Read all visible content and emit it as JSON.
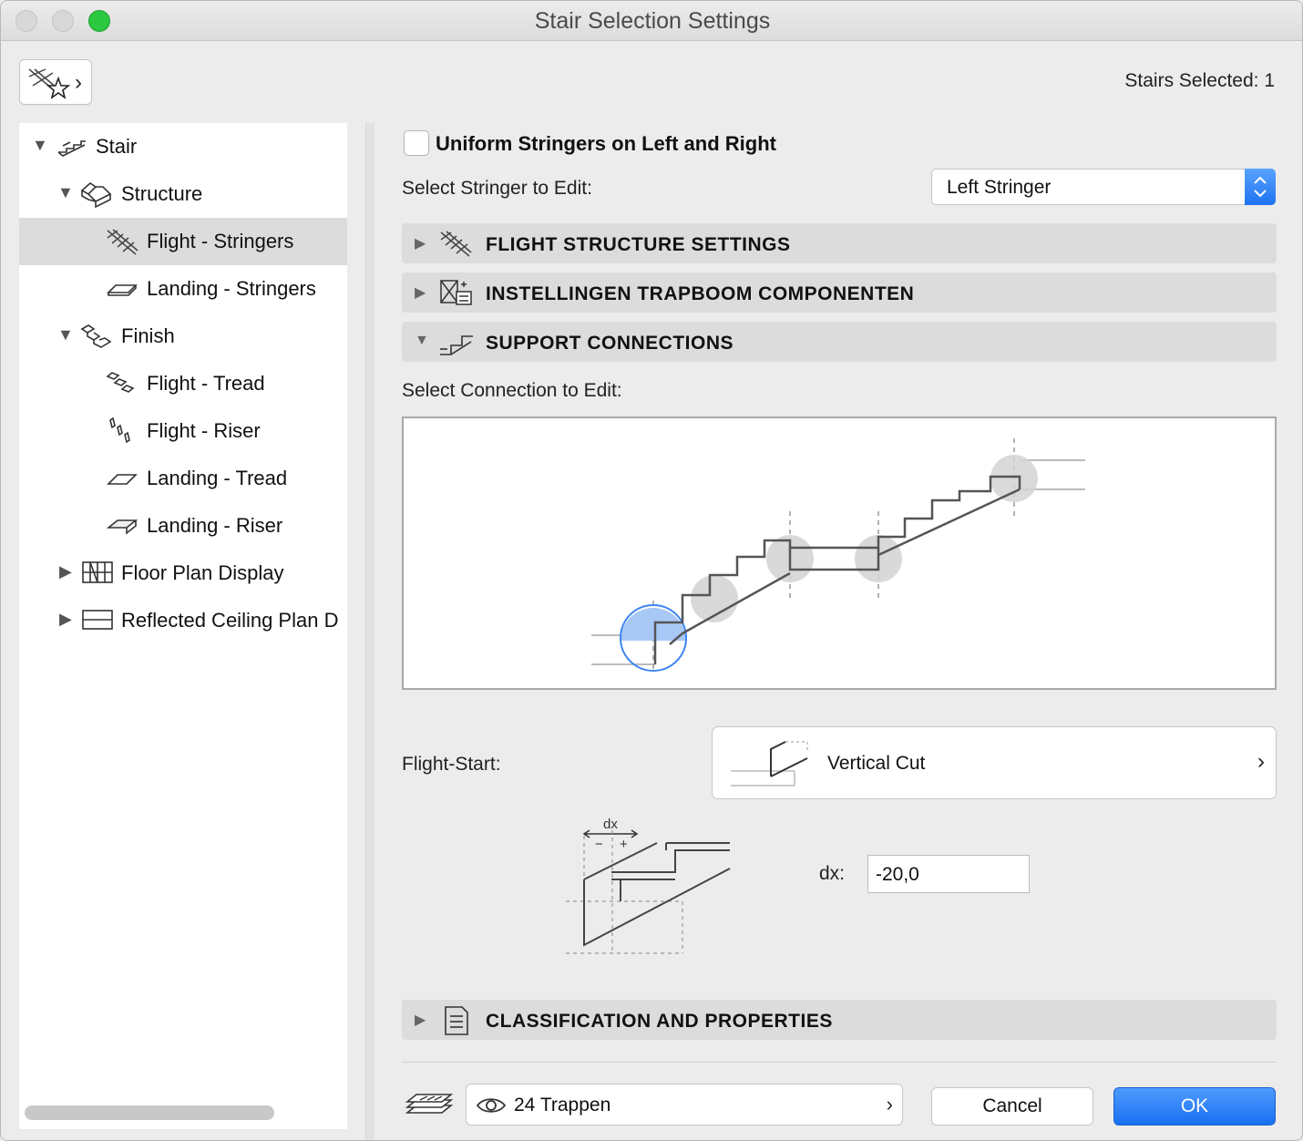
{
  "window": {
    "title": "Stair Selection Settings"
  },
  "toolbar": {
    "selection_status": "Stairs Selected: 1"
  },
  "tree": {
    "items": [
      {
        "label": "Stair",
        "icon": "stair-icon",
        "expanded": true
      },
      {
        "label": "Structure",
        "icon": "structure-icon",
        "expanded": true
      },
      {
        "label": "Flight - Stringers",
        "icon": "flight-stringers-icon",
        "selected": true
      },
      {
        "label": "Landing - Stringers",
        "icon": "landing-stringers-icon"
      },
      {
        "label": "Finish",
        "icon": "finish-icon",
        "expanded": true
      },
      {
        "label": "Flight - Tread",
        "icon": "flight-tread-icon"
      },
      {
        "label": "Flight - Riser",
        "icon": "flight-riser-icon"
      },
      {
        "label": "Landing - Tread",
        "icon": "landing-tread-icon"
      },
      {
        "label": "Landing - Riser",
        "icon": "landing-riser-icon"
      },
      {
        "label": "Floor Plan Display",
        "icon": "floor-plan-icon",
        "expanded": false
      },
      {
        "label": "Reflected Ceiling Plan D",
        "icon": "ceiling-plan-icon",
        "expanded": false
      }
    ]
  },
  "panel": {
    "uniform_label": "Uniform Stringers on Left and Right",
    "uniform_checked": false,
    "select_stringer_label": "Select Stringer to Edit:",
    "stringer_value": "Left Stringer",
    "sections": [
      {
        "label": "FLIGHT STRUCTURE SETTINGS",
        "expanded": false
      },
      {
        "label": "INSTELLINGEN TRAPBOOM COMPONENTEN",
        "expanded": false
      },
      {
        "label": "SUPPORT CONNECTIONS",
        "expanded": true
      },
      {
        "label": "CLASSIFICATION AND PROPERTIES",
        "expanded": false
      }
    ],
    "select_connection_label": "Select Connection to Edit:",
    "flight_start_label": "Flight-Start:",
    "flight_start_value": "Vertical Cut",
    "dx_diagram_label": "dx",
    "dx_minus": "−",
    "dx_plus": "+",
    "dx_label": "dx:",
    "dx_value": "-20,0"
  },
  "footer": {
    "layer_value": "24 Trappen",
    "cancel_label": "Cancel",
    "ok_label": "OK"
  },
  "colors": {
    "accent": "#1a6ff0",
    "highlight": "#4f93f2"
  }
}
